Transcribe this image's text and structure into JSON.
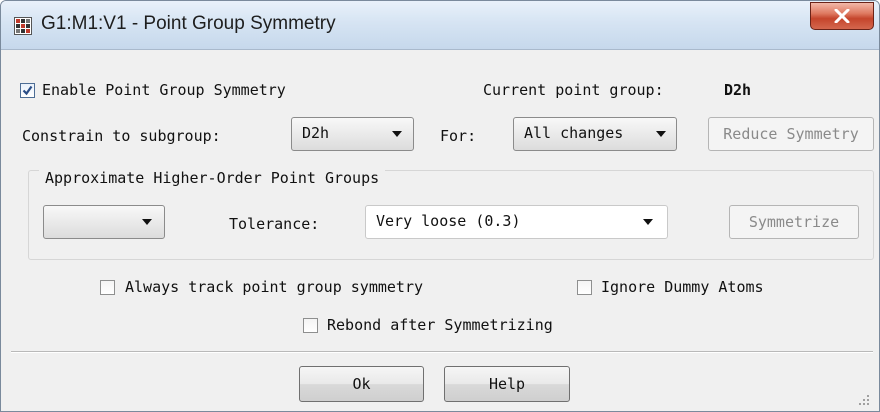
{
  "window": {
    "title": "G1:M1:V1 - Point Group Symmetry"
  },
  "titlebar": {
    "app_icon": "grid-app-icon",
    "close_icon": "close-x-icon"
  },
  "symmetry": {
    "enable_label": "Enable Point Group Symmetry",
    "enable_checked": true,
    "current_label": "Current point group:",
    "current_value": "D2h"
  },
  "constrain": {
    "label": "Constrain to subgroup:",
    "subgroup_value": "D2h",
    "for_label": "For:",
    "for_value": "All changes",
    "reduce_button": "Reduce Symmetry"
  },
  "approx": {
    "group_title": "Approximate Higher-Order Point Groups",
    "group_value": "",
    "tolerance_label": "Tolerance:",
    "tolerance_value": "Very loose (0.3)",
    "symmetrize_button": "Symmetrize"
  },
  "options": {
    "always_track_label": "Always track point group symmetry",
    "always_track_checked": false,
    "ignore_dummy_label": "Ignore Dummy Atoms",
    "ignore_dummy_checked": false,
    "rebond_label": "Rebond after Symmetrizing",
    "rebond_checked": false
  },
  "footer": {
    "ok_label": "Ok",
    "help_label": "Help"
  }
}
